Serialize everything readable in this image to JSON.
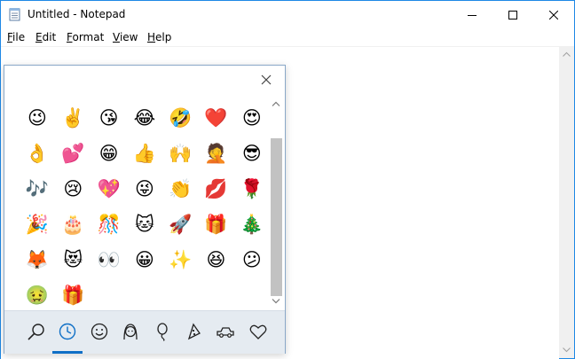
{
  "window": {
    "title": "Untitled - Notepad",
    "accent": "#1e88e5"
  },
  "menu": [
    {
      "label": "File",
      "accel": "F",
      "rest": "ile"
    },
    {
      "label": "Edit",
      "accel": "E",
      "rest": "dit"
    },
    {
      "label": "Format",
      "accel": "F",
      "rest": "ormat"
    },
    {
      "label": "View",
      "accel": "V",
      "rest": "iew"
    },
    {
      "label": "Help",
      "accel": "H",
      "rest": "elp"
    }
  ],
  "emoji_panel": {
    "active_tab": "recent",
    "tabs": [
      "search",
      "recent",
      "smileys",
      "people",
      "celebration",
      "food",
      "travel",
      "symbols"
    ],
    "rows": [
      [
        "😉",
        "✌️",
        "😘",
        "😂",
        "🤣",
        "❤️",
        "😍"
      ],
      [
        "👌",
        "💕",
        "😁",
        "👍",
        "🙌",
        "🤦",
        "😎"
      ],
      [
        "🎶",
        "😢",
        "💖",
        "😜",
        "👏",
        "💋",
        "🌹"
      ],
      [
        "🎉",
        "🎂",
        "🎊",
        "🐱",
        "🚀",
        "🎁",
        "🎄"
      ],
      [
        "🦊",
        "😻",
        "👀",
        "😀",
        "✨",
        "😆",
        "😕"
      ],
      [
        "🤢",
        "🎁"
      ]
    ]
  }
}
